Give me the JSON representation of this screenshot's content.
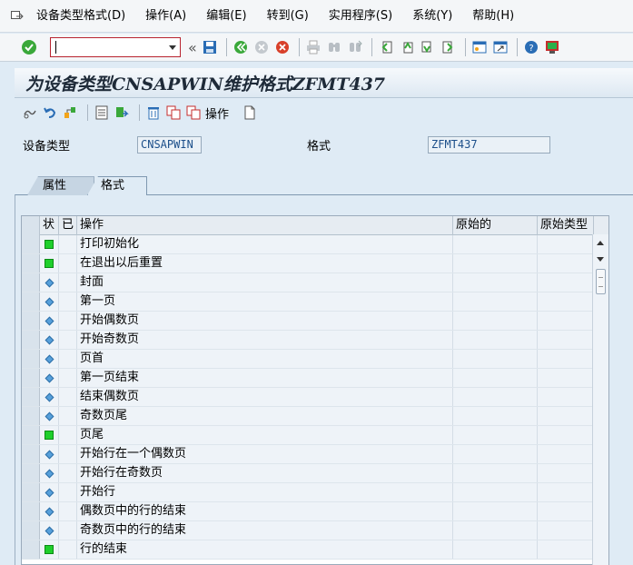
{
  "menubar": {
    "items": [
      "设备类型格式(D)",
      "操作(A)",
      "编辑(E)",
      "转到(G)",
      "实用程序(S)",
      "系统(Y)",
      "帮助(H)"
    ]
  },
  "toolbar": {
    "command_value": "",
    "icons": [
      "enter-icon",
      "command-field",
      "save-icon",
      "back-icon",
      "exit-icon",
      "cancel-icon",
      "print-icon",
      "find-icon",
      "find-next-icon",
      "first-page-icon",
      "previous-page-icon",
      "next-page-icon",
      "last-page-icon",
      "create-session-icon",
      "shortcut-icon",
      "help-icon",
      "customize-layout-icon"
    ]
  },
  "title": "为设备类型CNSAPWIN维护格式ZFMT437",
  "app_toolbar": {
    "action_label": "操作"
  },
  "fields": {
    "device_type_label": "设备类型",
    "device_type_value": "CNSAPWIN",
    "format_label": "格式",
    "format_value": "ZFMT437"
  },
  "tabs": [
    {
      "label": "属性",
      "active": false
    },
    {
      "label": "格式",
      "active": true
    }
  ],
  "table": {
    "columns": [
      "状",
      "已",
      "操作",
      "原始的",
      "原始类型"
    ],
    "rows": [
      {
        "status": "green",
        "op": "打印初始化"
      },
      {
        "status": "green",
        "op": "在退出以后重置"
      },
      {
        "status": "blue",
        "op": "封面"
      },
      {
        "status": "blue",
        "op": "第一页"
      },
      {
        "status": "blue",
        "op": "开始偶数页"
      },
      {
        "status": "blue",
        "op": "开始奇数页"
      },
      {
        "status": "blue",
        "op": "页首"
      },
      {
        "status": "blue",
        "op": "第一页结束"
      },
      {
        "status": "blue",
        "op": "结束偶数页"
      },
      {
        "status": "blue",
        "op": "奇数页尾"
      },
      {
        "status": "green",
        "op": "页尾"
      },
      {
        "status": "blue",
        "op": "开始行在一个偶数页"
      },
      {
        "status": "blue",
        "op": "开始行在奇数页"
      },
      {
        "status": "blue",
        "op": "开始行"
      },
      {
        "status": "blue",
        "op": "偶数页中的行的结束"
      },
      {
        "status": "blue",
        "op": "奇数页中的行的结束"
      },
      {
        "status": "green",
        "op": "行的结束"
      }
    ]
  },
  "colors": {
    "status_green": "#1fcf2b",
    "status_blue": "#56a0db",
    "background": "#dfebf5"
  }
}
